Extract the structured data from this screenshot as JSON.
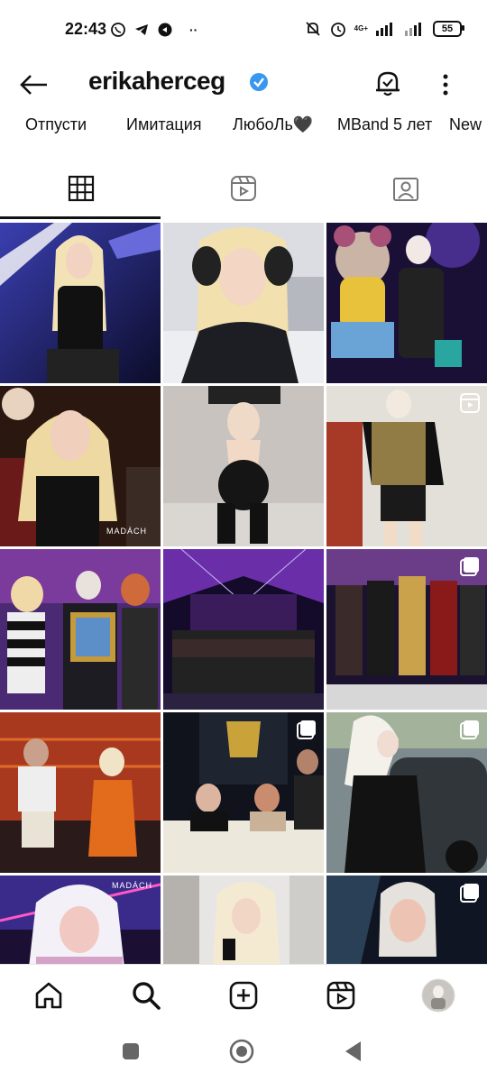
{
  "status_bar": {
    "time": "22:43",
    "network": "4G+",
    "battery": "55"
  },
  "header": {
    "username": "erikaherceg"
  },
  "highlights": [
    {
      "label": "Отпусти"
    },
    {
      "label": "Имитация"
    },
    {
      "label": "ЛюбоЛь🖤"
    },
    {
      "label": "MBand 5 лет"
    },
    {
      "label": "New"
    }
  ],
  "tabs": [
    {
      "name": "grid-icon",
      "active": true
    },
    {
      "name": "reels-icon",
      "active": false
    },
    {
      "name": "tagged-icon",
      "active": false
    }
  ],
  "posts": [
    {
      "badge": "none"
    },
    {
      "badge": "none"
    },
    {
      "badge": "none"
    },
    {
      "badge": "none",
      "watermark": "MADÁCH"
    },
    {
      "badge": "none"
    },
    {
      "badge": "reel"
    },
    {
      "badge": "none"
    },
    {
      "badge": "none"
    },
    {
      "badge": "carousel"
    },
    {
      "badge": "none"
    },
    {
      "badge": "carousel"
    },
    {
      "badge": "carousel"
    },
    {
      "badge": "none",
      "watermark": "MADÁCH"
    },
    {
      "badge": "none"
    },
    {
      "badge": "carousel"
    }
  ],
  "colors": {
    "accent_blue": "#3897f0",
    "text": "#111111"
  }
}
